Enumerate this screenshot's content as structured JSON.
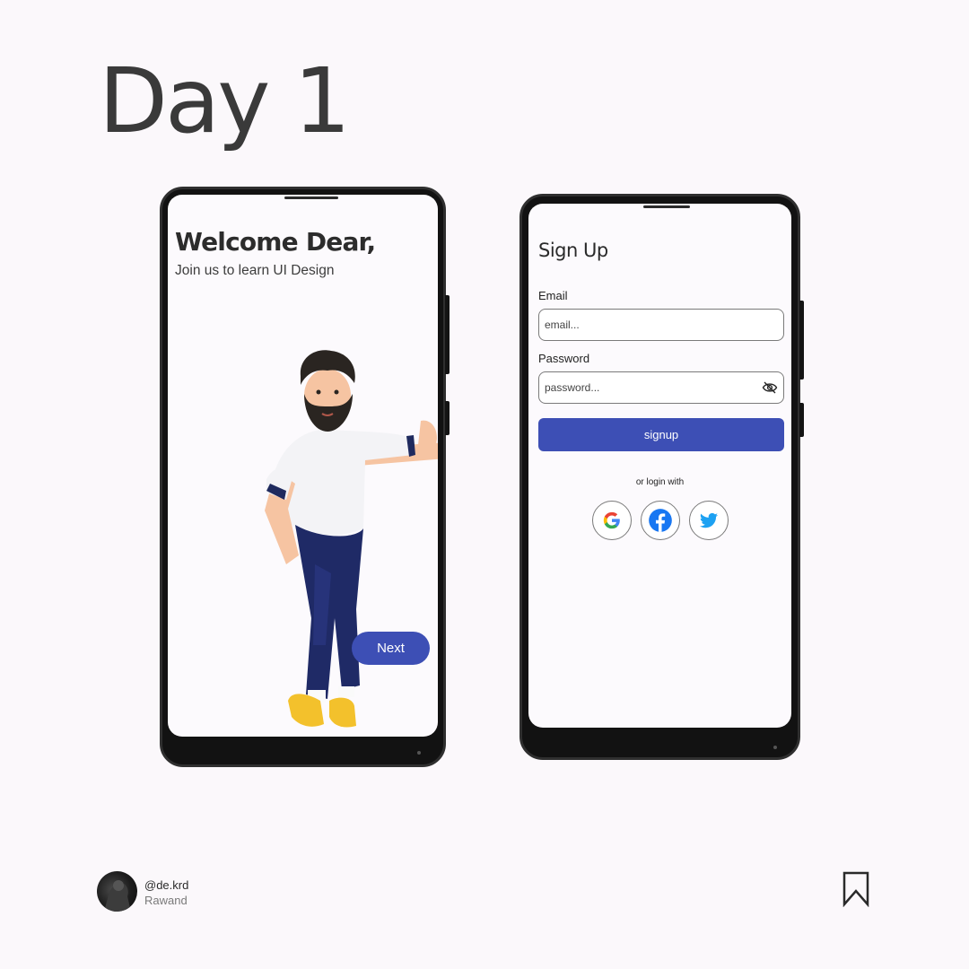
{
  "header": {
    "title": "Day 1"
  },
  "welcome_screen": {
    "title": "Welcome Dear,",
    "subtitle": "Join us to learn UI Design",
    "next_label": "Next"
  },
  "signup_screen": {
    "title": "Sign Up",
    "email_label": "Email",
    "email_placeholder": "email...",
    "password_label": "Password",
    "password_placeholder": "password...",
    "signup_label": "signup",
    "or_login_text": "or login with",
    "social": [
      "google-icon",
      "facebook-icon",
      "twitter-icon"
    ]
  },
  "footer": {
    "handle": "@de.krd",
    "name": "Rawand"
  },
  "colors": {
    "accent": "#3d4fb5",
    "background": "#fbf8fb",
    "phone_frame": "#121212"
  }
}
